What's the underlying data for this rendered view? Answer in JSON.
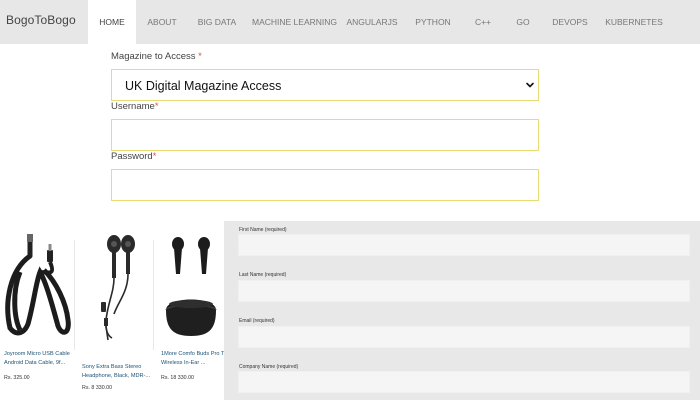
{
  "brand": "BogoToBogo",
  "nav": {
    "items": [
      "HOME",
      "ABOUT",
      "BIG DATA",
      "MACHINE LEARNING",
      "ANGULARJS",
      "PYTHON",
      "C++",
      "GO",
      "DEVOPS",
      "KUBERNETES"
    ],
    "active": "HOME"
  },
  "form": {
    "magazine_label": "Magazine to Access",
    "magazine_value": "UK Digital Magazine Access",
    "username_label": "Username",
    "password_label": "Password",
    "required_mark": "*"
  },
  "products": [
    {
      "name": "Joyroom Micro USB Cable Android Data Cable, 9f...",
      "price": "Rs. 325.00",
      "image": "usb-cable-icon"
    },
    {
      "name": "Sony Extra Bass Stereo Headphone, Black, MDR-...",
      "price": "Rs. 8 330.00",
      "image": "wired-earphones-icon"
    },
    {
      "name": "1More Comfo Buds Pro True Wireless In-Ear ...",
      "price": "Rs. 18 330.00",
      "image": "wireless-earbuds-icon"
    }
  ],
  "contact_form": {
    "first_name_label": "First Name (required)",
    "last_name_label": "Last Name (required)",
    "email_label": "Email (required)",
    "company_label": "Company Name (required)"
  },
  "colors": {
    "nav_bg": "#e7e7e7",
    "input_border": "#e8dc73",
    "required": "#d9534f",
    "product_link": "#1a5276",
    "panel_bg": "#e8e8e8"
  }
}
